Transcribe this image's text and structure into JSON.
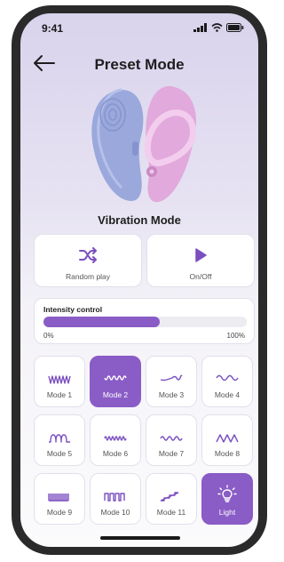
{
  "status": {
    "time": "9:41",
    "icons": [
      "signal-icon",
      "wifi-icon",
      "battery-icon"
    ]
  },
  "header": {
    "title": "Preset Mode",
    "back_icon": "arrow-left-icon"
  },
  "device": {
    "label": "Vibration Mode"
  },
  "controls": [
    {
      "label": "Random play",
      "icon": "shuffle-icon"
    },
    {
      "label": "On/Off",
      "icon": "play-icon"
    }
  ],
  "intensity": {
    "title": "Intensity control",
    "min_label": "0%",
    "max_label": "100%",
    "value": 0.57
  },
  "modes": [
    {
      "label": "Mode 1",
      "icon": "wave-icon",
      "active": false
    },
    {
      "label": "Mode 2",
      "icon": "wave-icon",
      "active": true
    },
    {
      "label": "Mode 3",
      "icon": "wave-icon",
      "active": false
    },
    {
      "label": "Mode 4",
      "icon": "wave-icon",
      "active": false
    },
    {
      "label": "Mode 5",
      "icon": "wave-icon",
      "active": false
    },
    {
      "label": "Mode 6",
      "icon": "wave-icon",
      "active": false
    },
    {
      "label": "Mode 7",
      "icon": "wave-icon",
      "active": false
    },
    {
      "label": "Mode 8",
      "icon": "wave-icon",
      "active": false
    },
    {
      "label": "Mode 9",
      "icon": "wave-icon",
      "active": false
    },
    {
      "label": "Mode 10",
      "icon": "wave-icon",
      "active": false
    },
    {
      "label": "Mode 11",
      "icon": "wave-icon",
      "active": false
    },
    {
      "label": "Light",
      "icon": "lightbulb-icon",
      "active": true
    }
  ],
  "colors": {
    "accent": "#8a5cc6",
    "device_blue": "#9aa8dc",
    "device_pink": "#e2a9dc"
  }
}
